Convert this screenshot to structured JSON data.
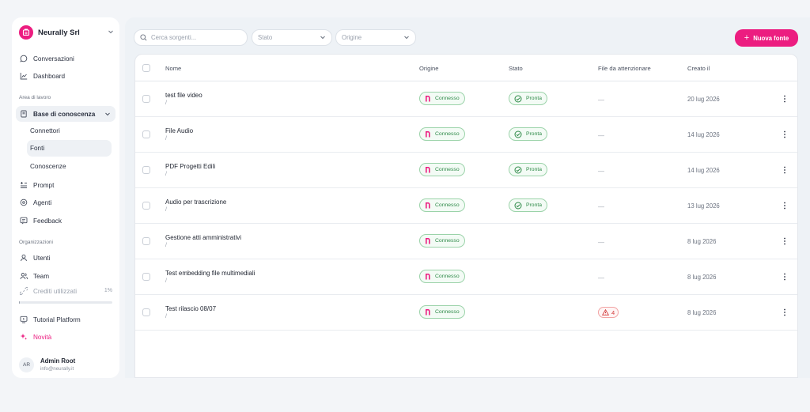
{
  "org": {
    "name": "Neurally Srl"
  },
  "sidebar": {
    "nav_top": [
      {
        "label": "Conversazioni",
        "icon": "chat-icon"
      },
      {
        "label": "Dashboard",
        "icon": "chart-icon"
      }
    ],
    "workspace_section": "Area di lavoro",
    "knowledge": {
      "label": "Base di conoscenza",
      "icon": "book-icon"
    },
    "knowledge_items": [
      "Connettori",
      "Fonti",
      "Conoscenze"
    ],
    "nav_mid": [
      {
        "label": "Prompt",
        "icon": "prompt-icon"
      },
      {
        "label": "Agenti",
        "icon": "agent-icon"
      },
      {
        "label": "Feedback",
        "icon": "feedback-icon"
      }
    ],
    "org_section": "Organizzazioni",
    "nav_org": [
      {
        "label": "Utenti",
        "icon": "user-icon"
      },
      {
        "label": "Team",
        "icon": "team-icon"
      }
    ],
    "credits": {
      "label": "Crediti utilizzati",
      "percent_label": "1%",
      "percent": 1
    },
    "nav_bottom": [
      {
        "label": "Tutorial Platform",
        "icon": "tutorial-icon"
      },
      {
        "label": "Novità",
        "icon": "sparkle-icon"
      }
    ],
    "user": {
      "initials": "AR",
      "name": "Admin Root",
      "email": "info@neurally.it"
    }
  },
  "toolbar": {
    "search_placeholder": "Cerca sorgenti...",
    "stato_filter": "Stato",
    "origine_filter": "Origine",
    "new_button": "Nuova fonte"
  },
  "table": {
    "columns": {
      "name": "Nome",
      "origin": "Origine",
      "status": "Stato",
      "files": "File da attenzionare",
      "created": "Creato il"
    },
    "rows": [
      {
        "name": "test file video",
        "path": "/",
        "origin": "Connesso",
        "status": "Pronta",
        "files": "—",
        "created": "20 lug 2026"
      },
      {
        "name": "File Audio",
        "path": "/",
        "origin": "Connesso",
        "status": "Pronta",
        "files": "—",
        "created": "14 lug 2026"
      },
      {
        "name": "PDF Progetti Edili",
        "path": "/",
        "origin": "Connesso",
        "status": "Pronta",
        "files": "—",
        "created": "14 lug 2026"
      },
      {
        "name": "Audio per trascrizione",
        "path": "/",
        "origin": "Connesso",
        "status": "Pronta",
        "files": "—",
        "created": "13 lug 2026"
      },
      {
        "name": "Gestione atti amministrativi",
        "path": "/",
        "origin": "Connesso",
        "status": "",
        "files": "—",
        "created": "8 lug 2026"
      },
      {
        "name": "Test embedding file multimediali",
        "path": "/",
        "origin": "Connesso",
        "status": "",
        "files": "—",
        "created": "8 lug 2026"
      },
      {
        "name": "Test rilascio 08/07",
        "path": "/",
        "origin": "Connesso",
        "status": "",
        "files": "",
        "warning_count": "4",
        "created": "8 lug 2026"
      }
    ]
  },
  "colors": {
    "accent": "#ec1d80",
    "success": "#2e8a48",
    "danger": "#d23b3b"
  }
}
